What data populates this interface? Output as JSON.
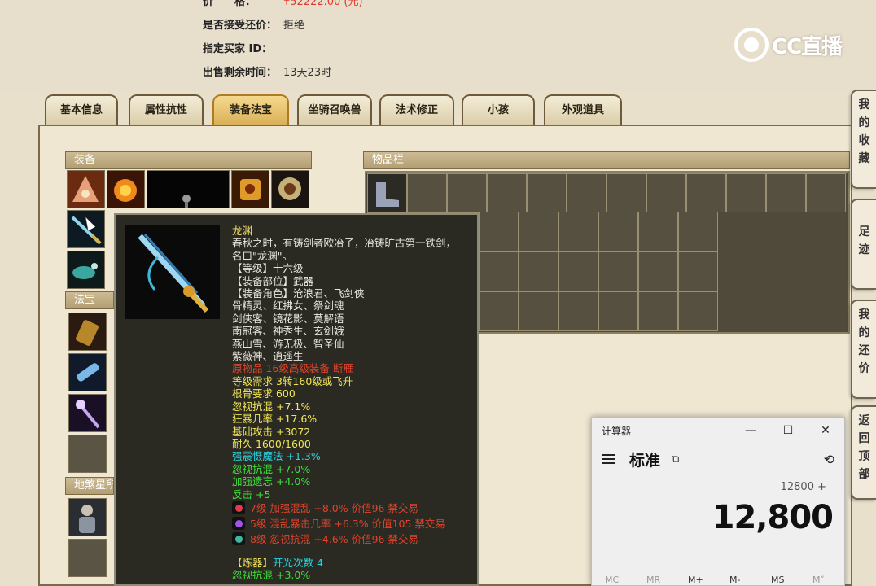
{
  "listing": {
    "price_label": "价　　格：",
    "price_value": "¥52222.00 (元)",
    "bargain_label": "是否接受还价：",
    "bargain_value": "拒绝",
    "buyer_label": "指定买家 ID：",
    "buyer_value": "",
    "remaining_label": "出售剩余时间：",
    "remaining_value": "13天23时"
  },
  "logo": {
    "text": "CC直播"
  },
  "tabs": [
    {
      "label": "基本信息"
    },
    {
      "label": "属性抗性"
    },
    {
      "label": "装备法宝",
      "active": true
    },
    {
      "label": "坐骑召唤兽"
    },
    {
      "label": "法术修正"
    },
    {
      "label": "小孩"
    },
    {
      "label": "外观道具"
    }
  ],
  "panels": {
    "equipment": "装备",
    "fabao": "法宝",
    "dishaxing": "地煞星所",
    "inventory": "物品栏"
  },
  "tooltip": {
    "name": "龙渊",
    "desc1": "春秋之时，有铸剑者欧冶子，冶铸旷古第一铁剑，",
    "desc2": "名曰\"龙渊\"。",
    "level": "【等级】十六级",
    "slot": "【装备部位】武器",
    "roles1": "【装备角色】沧浪君、飞剑侠",
    "roles2": "骨精灵、红拂女、祭剑魂",
    "roles3": "剑侠客、镜花影、莫解语",
    "roles4": "南冠客、神秀生、玄剑娥",
    "roles5": "燕山雪、游无极、智圣仙",
    "roles6": "紫薇神、逍遥生",
    "origin": "原物品 16级高级装备 断雁",
    "req_level": "等级需求 3转160级或飞升",
    "req_bone": "根骨要求 600",
    "stat1": "忽视抗混 +7.1%",
    "stat2": "狂暴几率 +17.6%",
    "stat3": "基础攻击 +3072",
    "stat4": "耐久 1600/1600",
    "stat5": "强震慑魔法 +1.3%",
    "stat6": "忽视抗混 +7.0%",
    "stat7": "加强遗忘 +4.0%",
    "stat8": "反击 +5",
    "gem1": "7级 加强混乱 +8.0% 价值96 禁交易",
    "gem2": "5级 混乱暴击几率 +6.3% 价值105 禁交易",
    "gem3": "8级 忽视抗混 +4.6% 价值96 禁交易",
    "refine_label": "【炼器】",
    "refine_value": "开光次数 4",
    "refine_stat": "忽视抗混 +3.0%"
  },
  "side_nav": [
    {
      "label": "我的收藏"
    },
    {
      "label": "足迹"
    },
    {
      "label": "我的还价"
    },
    {
      "label": "返回顶部"
    }
  ],
  "calculator": {
    "title": "计算器",
    "mode": "标准",
    "expression": "12800 +",
    "display": "12,800",
    "memory": [
      "MC",
      "MR",
      "M+",
      "M-",
      "MS",
      "M˅"
    ]
  },
  "colors": {
    "price": "#e23a2f",
    "tab_active": "#d7ad55",
    "tooltip_bg": "#2b2a22",
    "text_green": "#3de23c",
    "text_cyan": "#27d7e4",
    "text_red": "#e0432b"
  }
}
